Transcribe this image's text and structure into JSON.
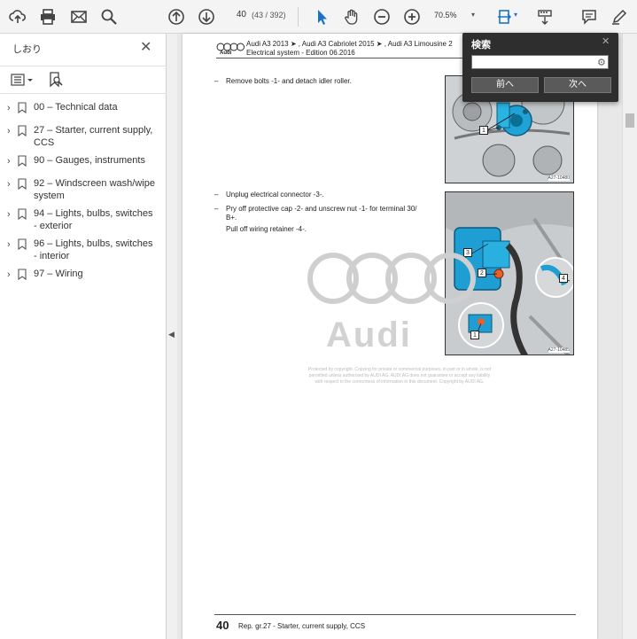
{
  "toolbar": {
    "page_number": "40",
    "page_total": "(43 / 392)",
    "zoom": "70.5%",
    "icons": [
      "cloud-upload-icon",
      "print-icon",
      "mail-icon",
      "zoom-search-icon",
      "page-up-icon",
      "page-down-icon",
      "select-cursor-icon",
      "hand-icon",
      "zoom-out-icon",
      "zoom-in-icon",
      "fit-page-icon",
      "scroll-mode-icon",
      "comment-icon",
      "pen-icon"
    ]
  },
  "sidebar": {
    "title": "しおり",
    "bookmarks": [
      {
        "label": "00 – Technical data"
      },
      {
        "label": "27 – Starter, current supply, CCS"
      },
      {
        "label": "90 – Gauges, instruments"
      },
      {
        "label": "92 – Windscreen wash/wipe system"
      },
      {
        "label": "94 – Lights, bulbs, switches - exterior"
      },
      {
        "label": "96 – Lights, bulbs, switches - interior"
      },
      {
        "label": "97 – Wiring"
      }
    ]
  },
  "document": {
    "header_line1": "Audi A3 2013 ➤ , Audi A3 Cabriolet 2015 ➤ , Audi A3 Limousine 2",
    "header_line2": "Electrical system - Edition 06.2016",
    "header_brand": "Audi",
    "step1": "Remove bolts -1- and detach idler roller.",
    "step2": "Unplug electrical connector -3-.",
    "step3a": "Pry off protective cap -2- and unscrew nut -1- for terminal 30/",
    "step3b": "B+.",
    "step4": "Pull off wiring retainer -4-.",
    "fig1_code": "A27-10480",
    "fig2_code": "A27-10485",
    "fig1_callout": "1",
    "fig2_callouts": [
      "3",
      "2",
      "4",
      "1"
    ],
    "watermark_word": "Audi",
    "copyright_lines": [
      "Protected by copyright. Copying for private or commercial purposes, in part or in whole, is not",
      "permitted unless authorised by AUDI AG. AUDI AG does not guarantee or accept any liability",
      "with respect to the correctness of information in this document. Copyright by AUDI AG."
    ],
    "footer_page": "40",
    "footer_text": "Rep. gr.27 - Starter, current supply, CCS"
  },
  "search": {
    "title": "検索",
    "input_value": "",
    "prev_label": "前へ",
    "next_label": "次へ"
  }
}
